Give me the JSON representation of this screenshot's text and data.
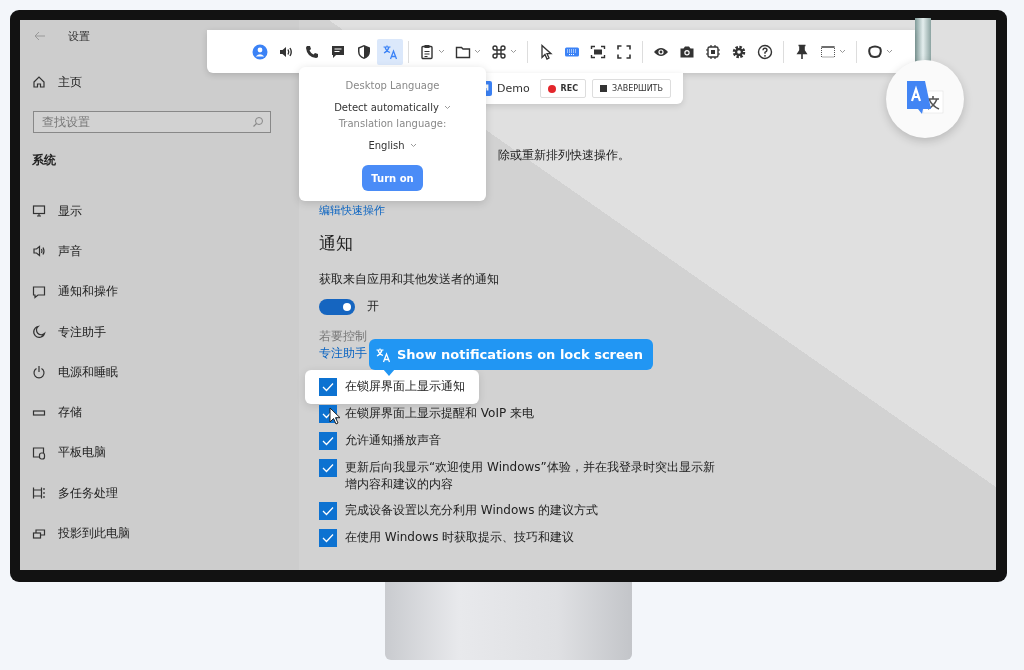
{
  "window": {
    "title": "设置"
  },
  "sidebar": {
    "home": "主页",
    "search": {
      "placeholder": "查找设置"
    },
    "section": "系统",
    "items": [
      {
        "label": "显示"
      },
      {
        "label": "声音"
      },
      {
        "label": "通知和操作"
      },
      {
        "label": "专注助手"
      },
      {
        "label": "电源和睡眠"
      },
      {
        "label": "存储"
      },
      {
        "label": "平板电脑"
      },
      {
        "label": "多任务处理"
      },
      {
        "label": "投影到此电脑"
      }
    ]
  },
  "main": {
    "description": "除或重新排列快速操作。",
    "link": "编辑快速操作",
    "heading": "通知",
    "toggle_label": "获取来自应用和其他发送者的通知",
    "toggle": {
      "on": true,
      "text": "开"
    },
    "hint": "若要控制",
    "hint_link": "专注助手",
    "checkboxes": [
      {
        "label": "在锁屏界面上显示通知",
        "checked": true,
        "highlighted": true
      },
      {
        "label": "在锁屏界面上显示提醒和 VoIP 来电",
        "checked": true,
        "highlighted": false
      },
      {
        "label": "允许通知播放声音",
        "checked": true,
        "highlighted": false
      },
      {
        "label": "更新后向我显示“欢迎使用 Windows”体验，并在我登录时突出显示新增内容和建议的内容",
        "checked": true,
        "highlighted": false
      },
      {
        "label": "完成设备设置以充分利用 Windows 的建议方式",
        "checked": true,
        "highlighted": false
      },
      {
        "label": "在使用 Windows 时获取提示、技巧和建议",
        "checked": true,
        "highlighted": false
      }
    ]
  },
  "toolbar": {
    "items": [
      {
        "selected": false,
        "dropdown": false
      },
      {
        "selected": false,
        "dropdown": false
      },
      {
        "selected": false,
        "dropdown": false
      },
      {
        "selected": false,
        "dropdown": false
      },
      {
        "selected": false,
        "dropdown": false
      },
      {
        "selected": true,
        "dropdown": false
      },
      {
        "selected": false,
        "dropdown": true
      },
      {
        "selected": false,
        "dropdown": true
      },
      {
        "selected": false,
        "dropdown": true
      },
      {
        "selected": false,
        "dropdown": false
      },
      {
        "selected": false,
        "dropdown": false
      },
      {
        "selected": false,
        "dropdown": false
      },
      {
        "selected": false,
        "dropdown": false
      },
      {
        "selected": false,
        "dropdown": false
      },
      {
        "selected": false,
        "dropdown": false
      },
      {
        "selected": false,
        "dropdown": false
      },
      {
        "selected": false,
        "dropdown": false
      },
      {
        "selected": false,
        "dropdown": false
      },
      {
        "selected": false,
        "dropdown": false
      },
      {
        "selected": false,
        "dropdown": true
      },
      {
        "selected": false,
        "dropdown": true
      }
    ]
  },
  "language_popup": {
    "desktop_label": "Desktop Language",
    "desktop_value": "Detect automatically",
    "translation_label": "Translation language:",
    "translation_value": "English",
    "button": "Turn on"
  },
  "recording_bar": {
    "demo": "Demo",
    "rec": "REC",
    "finish": "ЗАВЕРШИТЬ"
  },
  "tooltip": {
    "text": "Show notifications on lock screen"
  }
}
